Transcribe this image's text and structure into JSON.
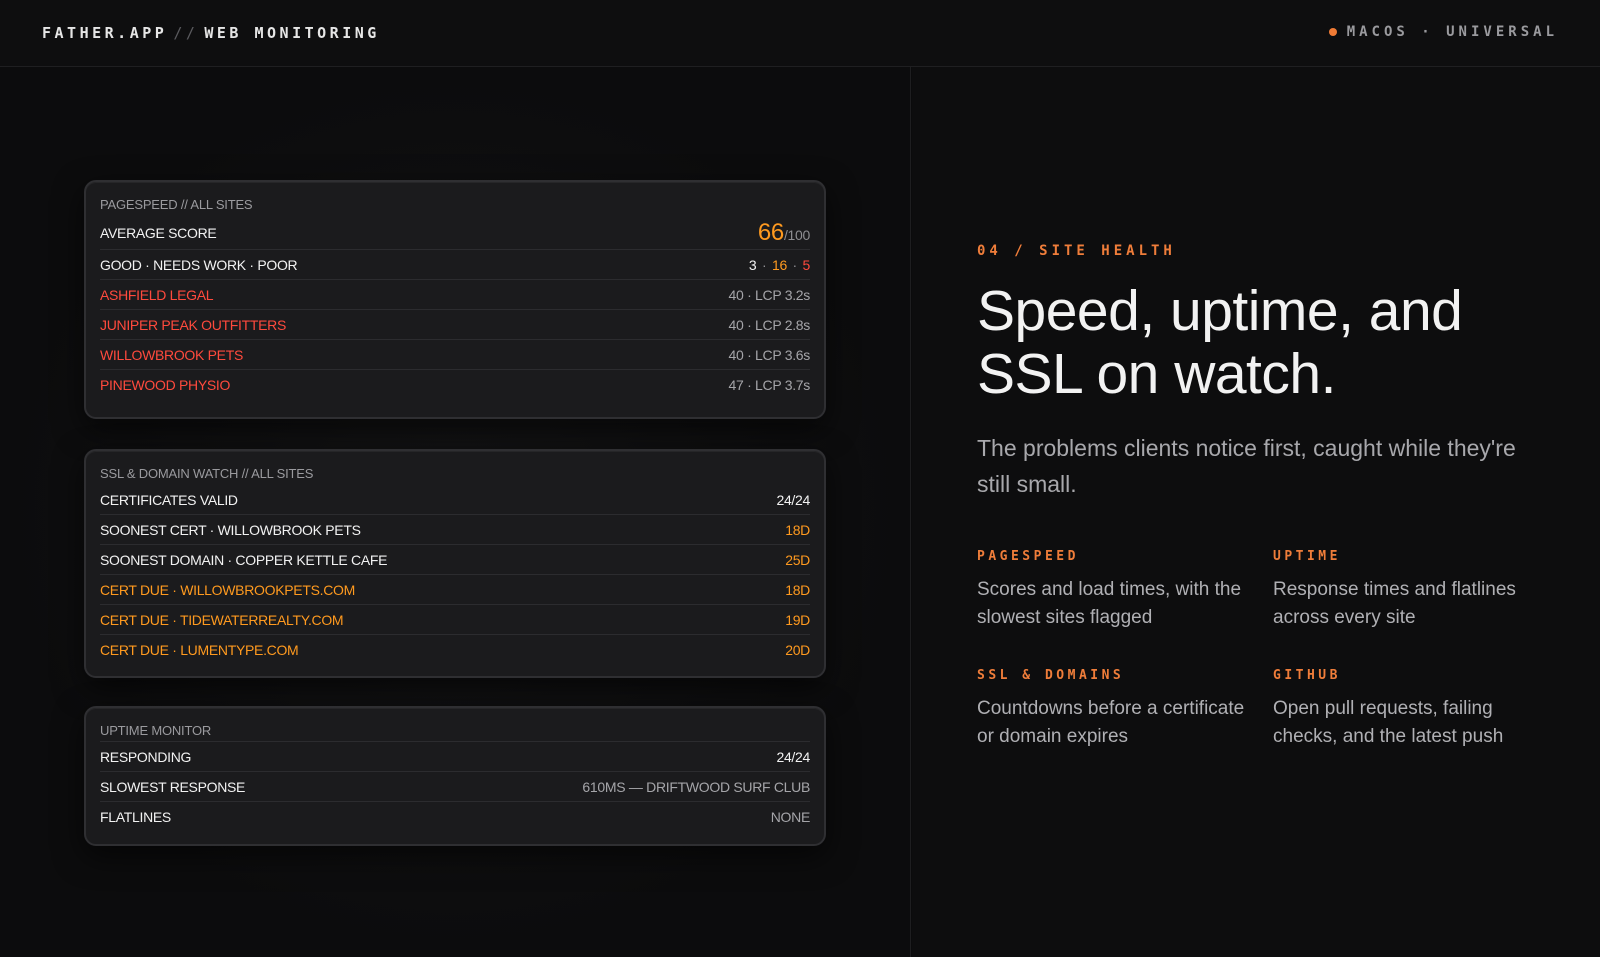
{
  "header": {
    "brand": "FATHER.APP",
    "separator": "//",
    "section": "WEB MONITORING",
    "platform": "MACOS · UNIVERSAL",
    "accent": "#f07b35"
  },
  "pagespeed": {
    "title": "PAGESPEED // ALL SITES",
    "average_label": "AVERAGE SCORE",
    "average_value": "66",
    "average_suffix": "/100",
    "buckets_label": "GOOD · NEEDS WORK · POOR",
    "good": "3",
    "needs_work": "16",
    "poor": "5",
    "sites": [
      {
        "name": "ASHFIELD LEGAL",
        "stat": "40 · LCP 3.2s"
      },
      {
        "name": "JUNIPER PEAK OUTFITTERS",
        "stat": "40 · LCP 2.8s"
      },
      {
        "name": "WILLOWBROOK PETS",
        "stat": "40 · LCP 3.6s"
      },
      {
        "name": "PINEWOOD PHYSIO",
        "stat": "47 · LCP 3.7s"
      }
    ]
  },
  "ssl": {
    "title": "SSL & DOMAIN WATCH // ALL SITES",
    "rows": [
      {
        "label": "CERTIFICATES VALID",
        "value": "24/24"
      },
      {
        "label": "SOONEST CERT · WILLOWBROOK PETS",
        "value": "18D"
      },
      {
        "label": "SOONEST DOMAIN · COPPER KETTLE CAFE",
        "value": "25D"
      },
      {
        "label": "CERT DUE · WILLOWBROOKPETS.COM",
        "value": "18D"
      },
      {
        "label": "CERT DUE · TIDEWATERREALTY.COM",
        "value": "19D"
      },
      {
        "label": "CERT DUE · LUMENTYPE.COM",
        "value": "20D"
      }
    ]
  },
  "uptime": {
    "title": "UPTIME MONITOR",
    "rows": [
      {
        "label": "RESPONDING",
        "value": "24/24"
      },
      {
        "label": "SLOWEST RESPONSE",
        "value": "610MS — DRIFTWOOD SURF CLUB"
      },
      {
        "label": "FLATLINES",
        "value": "NONE"
      }
    ]
  },
  "hero": {
    "eyebrow": "04 / SITE HEALTH",
    "headline_line1": "Speed, uptime, and",
    "headline_line2": "SSL on watch.",
    "subhead": "The problems clients notice first, caught while they're still small."
  },
  "features": [
    {
      "title": "PAGESPEED",
      "desc": "Scores and load times, with the slowest sites flagged"
    },
    {
      "title": "UPTIME",
      "desc": "Response times and flatlines across every site"
    },
    {
      "title": "SSL & DOMAINS",
      "desc": "Countdowns before a certificate or domain expires"
    },
    {
      "title": "GITHUB",
      "desc": "Open pull requests, failing checks, and the latest push"
    }
  ]
}
